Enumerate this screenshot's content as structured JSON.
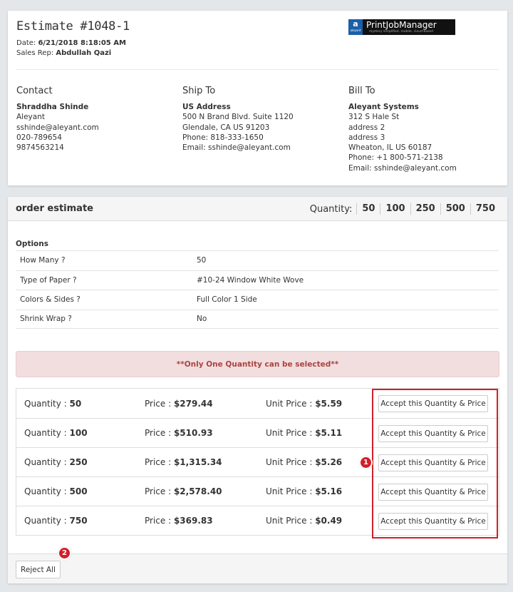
{
  "estimate": {
    "title": "Estimate #1048-1",
    "date_label": "Date:",
    "date_value": "6/21/2018 8:18:05 AM",
    "rep_label": "Sales Rep:",
    "rep_value": "Abdullah Qazi"
  },
  "logo": {
    "mark": "a",
    "mark_sub": "aleyant",
    "name": "PrintJobManager",
    "tagline": "mystery simplified. mobile. cloud-based"
  },
  "contact": {
    "heading": "Contact",
    "lines": [
      "Shraddha Shinde",
      "Aleyant",
      "sshinde@aleyant.com",
      "020-789654",
      "9874563214"
    ]
  },
  "ship_to": {
    "heading": "Ship To",
    "lines": [
      "US Address",
      "500 N Brand Blvd. Suite 1120",
      "Glendale, CA US 91203",
      "Phone: 818-333-1650",
      "Email: sshinde@aleyant.com"
    ]
  },
  "bill_to": {
    "heading": "Bill To",
    "lines": [
      "Aleyant Systems",
      "312 S Hale St",
      "address 2",
      "address 3",
      "Wheaton, IL US 60187",
      "Phone: +1 800-571-2138",
      "Email: sshinde@aleyant.com"
    ]
  },
  "order": {
    "title": "order estimate",
    "quantity_label": "Quantity:",
    "quantities": [
      "50",
      "100",
      "250",
      "500",
      "750"
    ]
  },
  "options": {
    "title": "Options",
    "rows": [
      {
        "key": "How Many ?",
        "value": "50"
      },
      {
        "key": "Type of Paper ?",
        "value": "#10-24 Window White Wove"
      },
      {
        "key": "Colors & Sides ?",
        "value": "Full Color 1 Side"
      },
      {
        "key": "Shrink Wrap ?",
        "value": "No"
      }
    ]
  },
  "alert": "**Only One Quantity can be selected**",
  "pricing": {
    "qty_label": "Quantity : ",
    "price_label": "Price : ",
    "unit_label": "Unit Price : ",
    "accept_label": "Accept this Quantity & Price",
    "rows": [
      {
        "qty": "50",
        "price": "$279.44",
        "unit": "$5.59"
      },
      {
        "qty": "100",
        "price": "$510.93",
        "unit": "$5.11"
      },
      {
        "qty": "250",
        "price": "$1,315.34",
        "unit": "$5.26"
      },
      {
        "qty": "500",
        "price": "$2,578.40",
        "unit": "$5.16"
      },
      {
        "qty": "750",
        "price": "$369.83",
        "unit": "$0.49"
      }
    ]
  },
  "footer": {
    "reject_label": "Reject All"
  },
  "annotations": {
    "badge1": "1",
    "badge2": "2",
    "highlight_color": "#d0202a"
  }
}
